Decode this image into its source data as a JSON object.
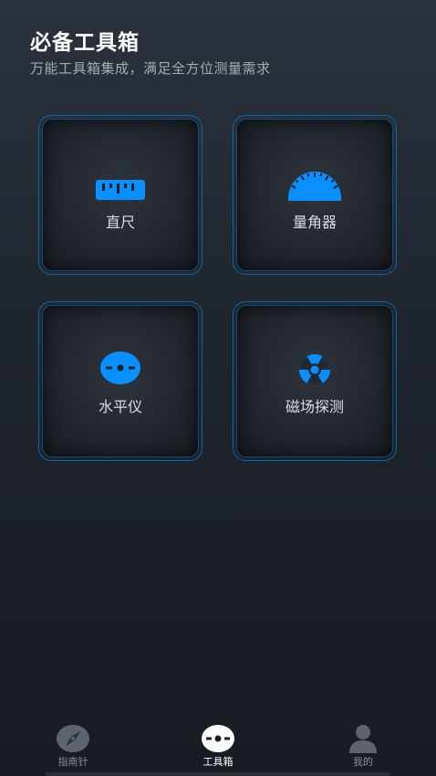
{
  "header": {
    "title": "必备工具箱",
    "subtitle": "万能工具箱集成，满足全方位测量需求"
  },
  "tools": [
    {
      "label": "直尺",
      "icon": "ruler-icon"
    },
    {
      "label": "量角器",
      "icon": "protractor-icon"
    },
    {
      "label": "水平仪",
      "icon": "level-icon"
    },
    {
      "label": "磁场探测",
      "icon": "magnetic-field-icon"
    }
  ],
  "tabbar": {
    "items": [
      {
        "label": "指南针",
        "icon": "compass-icon",
        "active": false
      },
      {
        "label": "工具箱",
        "icon": "toolbox-icon",
        "active": true
      },
      {
        "label": "我的",
        "icon": "user-icon",
        "active": false
      }
    ]
  },
  "colors": {
    "accent": "#0a8fff",
    "card_border": "#0d66a8",
    "background": "#1f252d"
  }
}
